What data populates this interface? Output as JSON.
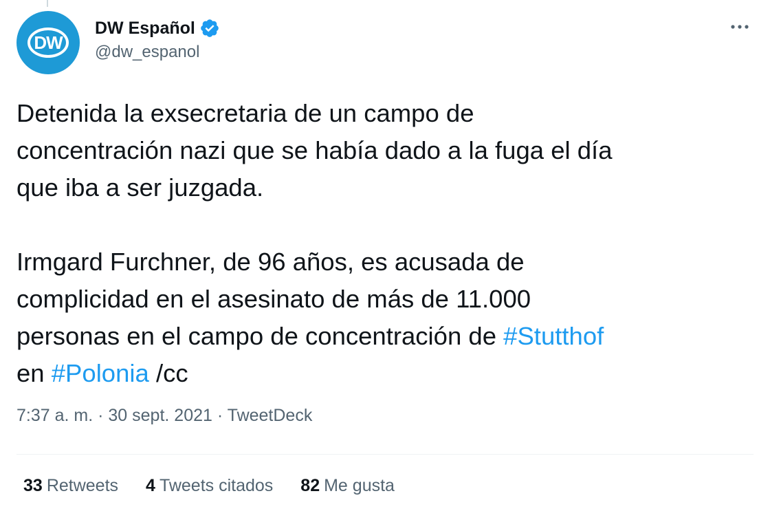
{
  "tweet": {
    "author": {
      "display_name": "DW Español",
      "handle": "@dw_espanol",
      "avatar_text": "DW",
      "verified": true
    },
    "body": {
      "para1": "Detenida la exsecretaria de un campo de\nconcentración nazi que se había dado a la fuga el día\nque iba a ser juzgada.",
      "para2_part1": "Irmgard Furchner, de 96 años, es acusada de\ncomplicidad en el asesinato de más de 11.000\npersonas en el campo de concentración de ",
      "hashtag1": "#Stutthof",
      "para2_part2": "\nen ",
      "hashtag2": "#Polonia",
      "para2_part3": " /cc"
    },
    "meta": {
      "time": "7:37 a. m.",
      "separator1": " · ",
      "date": "30 sept. 2021",
      "separator2": " · ",
      "source": "TweetDeck"
    },
    "stats": [
      {
        "count": "33",
        "label": "Retweets"
      },
      {
        "count": "4",
        "label": "Tweets citados"
      },
      {
        "count": "82",
        "label": "Me gusta"
      }
    ]
  },
  "colors": {
    "accent": "#1d9bf0",
    "avatar_bg": "#1e9ad6",
    "text_primary": "#0f1419",
    "text_secondary": "#536471",
    "divider": "#eff3f4"
  },
  "icons": {
    "verified": "verified-badge-icon",
    "more": "more-options-icon"
  }
}
